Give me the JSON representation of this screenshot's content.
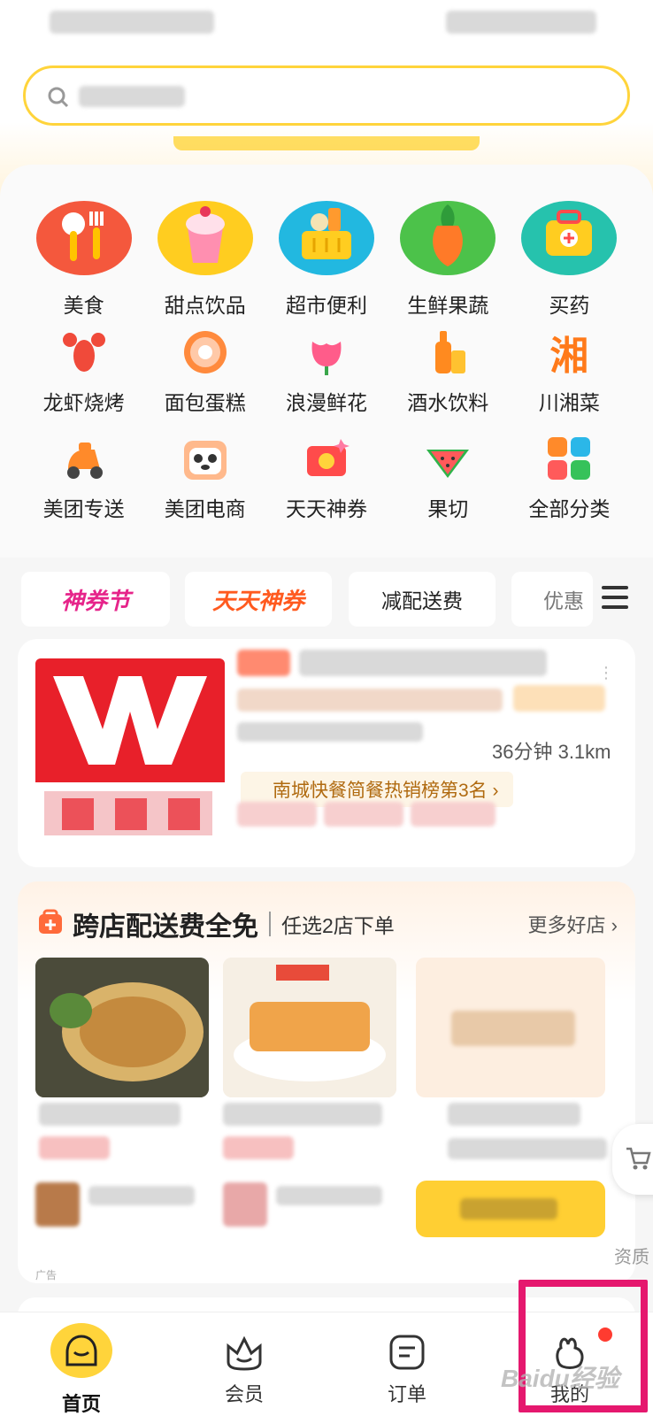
{
  "search": {
    "placeholder": ""
  },
  "categories_row1": [
    {
      "label": "美食",
      "icon": "tableware-icon"
    },
    {
      "label": "甜点饮品",
      "icon": "icecream-cup-icon"
    },
    {
      "label": "超市便利",
      "icon": "shopping-basket-icon"
    },
    {
      "label": "生鲜果蔬",
      "icon": "carrot-icon"
    },
    {
      "label": "买药",
      "icon": "medicine-box-icon"
    }
  ],
  "categories_row2": [
    {
      "label": "龙虾烧烤",
      "icon": "lobster-icon"
    },
    {
      "label": "面包蛋糕",
      "icon": "donut-icon"
    },
    {
      "label": "浪漫鲜花",
      "icon": "flower-icon"
    },
    {
      "label": "酒水饮料",
      "icon": "drinks-icon"
    },
    {
      "label": "川湘菜",
      "icon": "xiang-character-icon",
      "glyph": "湘"
    }
  ],
  "categories_row3": [
    {
      "label": "美团专送",
      "icon": "scooter-icon"
    },
    {
      "label": "美团电商",
      "icon": "panda-icon"
    },
    {
      "label": "天天神券",
      "icon": "coupon-icon"
    },
    {
      "label": "果切",
      "icon": "watermelon-icon"
    },
    {
      "label": "全部分类",
      "icon": "all-categories-icon"
    }
  ],
  "promo_chips": [
    "神券节",
    "天天神券",
    "减配送费",
    "优惠"
  ],
  "store": {
    "time_distance": "36分钟 3.1km",
    "rank": "南城快餐简餐热销榜第3名 ›"
  },
  "cross_store": {
    "title": "跨店配送费全免",
    "subtitle": "任选2店下单",
    "more": "更多好店 ›",
    "ad_tag": "广告"
  },
  "side": {
    "label": "资质"
  },
  "tabs": [
    {
      "label": "首页",
      "icon": "home-icon"
    },
    {
      "label": "会员",
      "icon": "member-crown-icon"
    },
    {
      "label": "订单",
      "icon": "order-icon"
    },
    {
      "label": "我的",
      "icon": "profile-icon"
    }
  ],
  "colors": {
    "brand_yellow": "#ffd43b",
    "highlight": "#e5186e"
  },
  "watermark": "Baidu经验"
}
